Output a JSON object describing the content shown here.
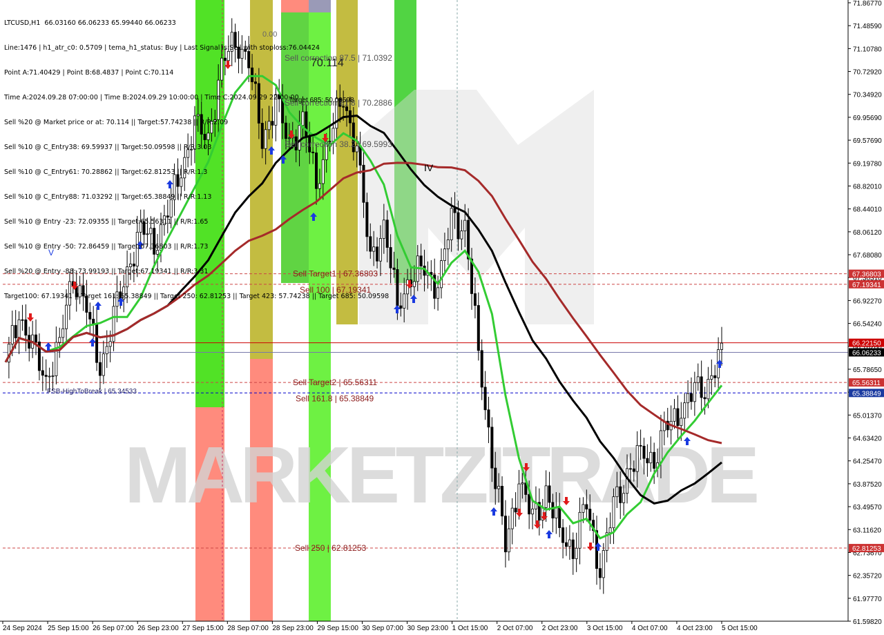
{
  "header": {
    "lines": [
      "LTCUSD,H1  66.03160 66.06233 65.99440 66.06233",
      "Line:1476 | h1_atr_c0: 0.5709 | tema_h1_status: Buy | Last Signal is:Sell with stoploss:76.04424",
      "Point A:71.40429 | Point B:68.4837 | Point C:70.114",
      "Time A:2024.09.28 07:00:00 | Time B:2024.09.29 10:00:00 | Time C:2024.09.29 22:00:00",
      "Sell %20 @ Market price or at: 70.114 || Target:57.74238 || R/R:2.09",
      "Sell %10 @ C_Entry38: 69.59937 || Target:50.09598 || R/R:3.03",
      "Sell %10 @ C_Entry61: 70.28862 || Target:62.81253 || R/R:1.3",
      "Sell %10 @ C_Entry88: 71.03292 || Target:65.38849 || R/R:1.13",
      "Sell %10 @ Entry -23: 72.09355 || Target:65.56311 || R/R:1.65",
      "Sell %10 @ Entry -50: 72.86459 || Target:67.36803 || R/R:1.73",
      "Sell %20 @ Entry -88: 73.99193 || Target:67.19341 || R/R:3.31",
      "Target100: 67.19341 || Target 161: 65.38849 || Target 250: 62.81253 || Target 423: 57.74238 || Target 685: 50.09598"
    ]
  },
  "colors": {
    "bg": "#ffffff",
    "bull": "#000000",
    "bear": "#000000",
    "ma_green": "#33cc33",
    "ma_black": "#000000",
    "ma_brown": "#a52a2a",
    "red_line": "#cc0000",
    "blue_line": "#0000cc",
    "label_dark": "#8b1a1a"
  },
  "chart_data": {
    "type": "candlestick",
    "symbol": "LTCUSD",
    "timeframe": "H1",
    "ylim": [
      61.5982,
      71.8677
    ],
    "y_ticks": [
      "71.86770",
      "71.48590",
      "71.10780",
      "70.72920",
      "70.34920",
      "69.95690",
      "69.57690",
      "69.19780",
      "68.82010",
      "68.44010",
      "68.06120",
      "67.68080",
      "67.30310",
      "66.92270",
      "66.54240",
      "66.16260",
      "65.78650",
      "65.40510",
      "65.01370",
      "64.63420",
      "64.25470",
      "63.87520",
      "63.49570",
      "63.11620",
      "62.73670",
      "62.35720",
      "61.97770",
      "61.59820"
    ],
    "x_labels": [
      "24 Sep 2024",
      "25 Sep 15:00",
      "26 Sep 07:00",
      "26 Sep 23:00",
      "27 Sep 15:00",
      "28 Sep 07:00",
      "28 Sep 23:00",
      "29 Sep 15:00",
      "30 Sep 07:00",
      "30 Sep 23:00",
      "1 Oct 15:00",
      "2 Oct 07:00",
      "2 Oct 23:00",
      "3 Oct 15:00",
      "4 Oct 07:00",
      "4 Oct 23:00",
      "5 Oct 15:00"
    ],
    "close_path": [
      65.9,
      66.7,
      66.1,
      65.6,
      66.2,
      67.4,
      66.8,
      65.8,
      66.6,
      67.4,
      68.1,
      67.9,
      68.4,
      69.1,
      69.8,
      69.6,
      70.8,
      71.3,
      70.9,
      69.6,
      70.2,
      69.5,
      69.9,
      68.9,
      69.7,
      70.3,
      69.4,
      67.6,
      68.1,
      66.9,
      67.3,
      67.5,
      67.1,
      68.3,
      68.1,
      66.1,
      64.3,
      62.9,
      63.9,
      63.3,
      63.7,
      63.1,
      62.8,
      63.6,
      62.4,
      63.5,
      64.0,
      64.4,
      64.3,
      64.9,
      65.1,
      65.4,
      65.5,
      66.06
    ],
    "price_labels": [
      {
        "value": "67.36803",
        "price": 67.36803,
        "color": "#cc3333"
      },
      {
        "value": "67.19341",
        "price": 67.19341,
        "color": "#cc3333"
      },
      {
        "value": "66.22150",
        "price": 66.2215,
        "color": "#cc0000"
      },
      {
        "value": "66.06233",
        "price": 66.06233,
        "color": "#000000"
      },
      {
        "value": "65.56311",
        "price": 65.56311,
        "color": "#cc3333"
      },
      {
        "value": "65.38849",
        "price": 65.38849,
        "color": "#1a3aa0"
      },
      {
        "value": "62.81253",
        "price": 62.81253,
        "color": "#cc3333"
      }
    ],
    "level_labels": [
      {
        "text": "Sell Target1 | 67.36803",
        "price": 67.36803
      },
      {
        "text": "Sell 100 | 67.19341",
        "price": 67.19341
      },
      {
        "text": "Sell Target2 | 65.56311",
        "price": 65.56311
      },
      {
        "text": "Sell 161.8 | 65.38849",
        "price": 65.38849
      },
      {
        "text": "Sell  250 | 62.81253",
        "price": 62.81253
      }
    ],
    "annotations": {
      "fsb_label": "FSB-HighToBreak | 65.34533",
      "sell_corr_875": "Sell correction 87.5 | 71.0392",
      "sell_corr_618": "Sell correction 61.8 | 70.2886",
      "sell_corr_382": "Sell correction 38.2 | 69.5993",
      "target685": "Target 685: 50.09598",
      "point_c": "70.114",
      "wave_iv": "IV",
      "wave_v": "V",
      "watermark": "MARKETZITRADE",
      "price_0_0": "0.00"
    }
  }
}
